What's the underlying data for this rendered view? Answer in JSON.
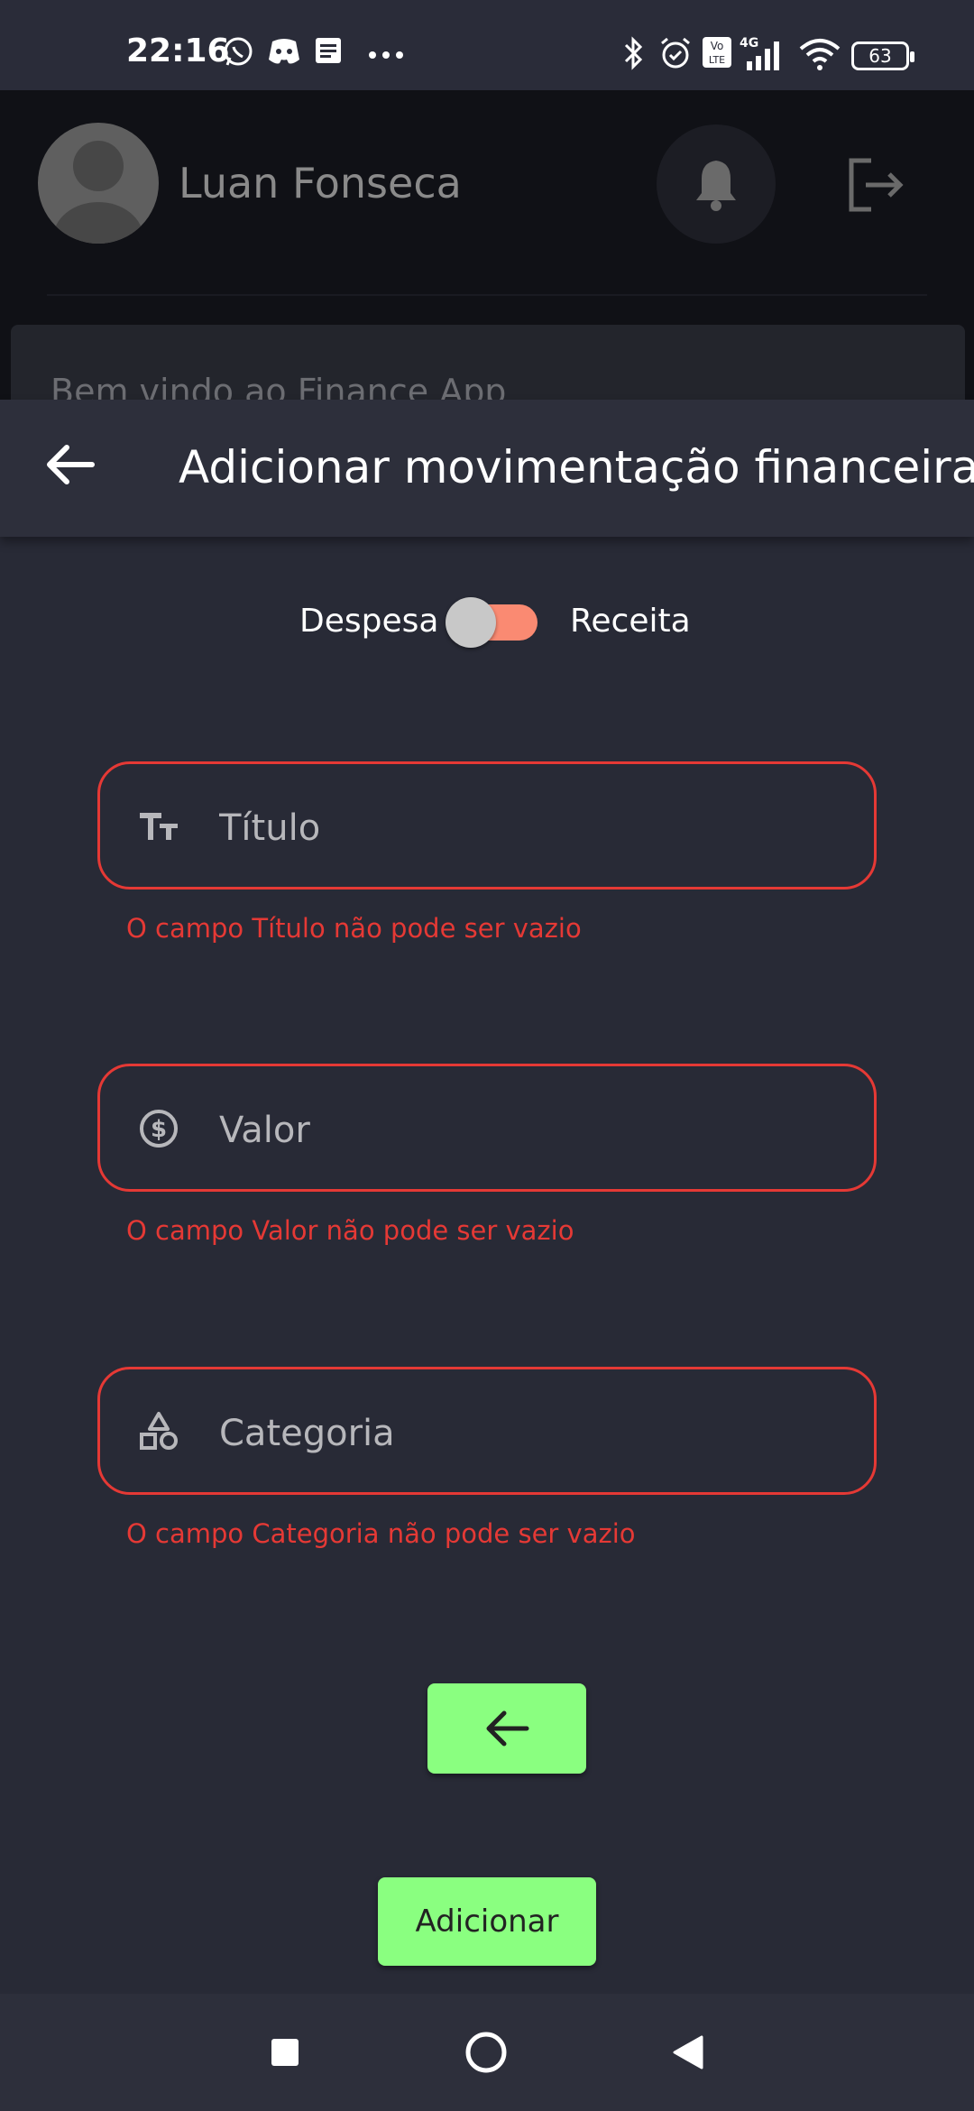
{
  "status_bar": {
    "time": "22:16",
    "battery": "63",
    "icons": [
      "whatsapp-icon",
      "discord-icon",
      "news-icon",
      "more-dots-icon",
      "bluetooth-icon",
      "alarm-icon",
      "volte-icon",
      "4g-signal-icon",
      "wifi-icon",
      "battery-icon"
    ]
  },
  "background_app": {
    "user_name": "Luan Fonseca",
    "welcome_text": "Bem vindo ao Finance App"
  },
  "modal": {
    "title": "Adicionar movimentação financeira",
    "toggle": {
      "left_label": "Despesa",
      "right_label": "Receita",
      "accent_color": "#fa8a72"
    },
    "fields": [
      {
        "placeholder": "Título",
        "icon": "text-format-icon",
        "error": "O campo Título não pode ser vazio"
      },
      {
        "placeholder": "Valor",
        "icon": "dollar-circle-icon",
        "error": "O campo Valor não pode ser vazio"
      },
      {
        "placeholder": "Categoria",
        "icon": "shapes-icon",
        "error": "O campo Categoria não pode ser vazio"
      }
    ],
    "add_button_label": "Adicionar",
    "button_color": "#8aff80",
    "error_color": "#e53935"
  },
  "nav_bar": {
    "icons": [
      "recent-apps-icon",
      "home-icon",
      "back-icon"
    ]
  }
}
